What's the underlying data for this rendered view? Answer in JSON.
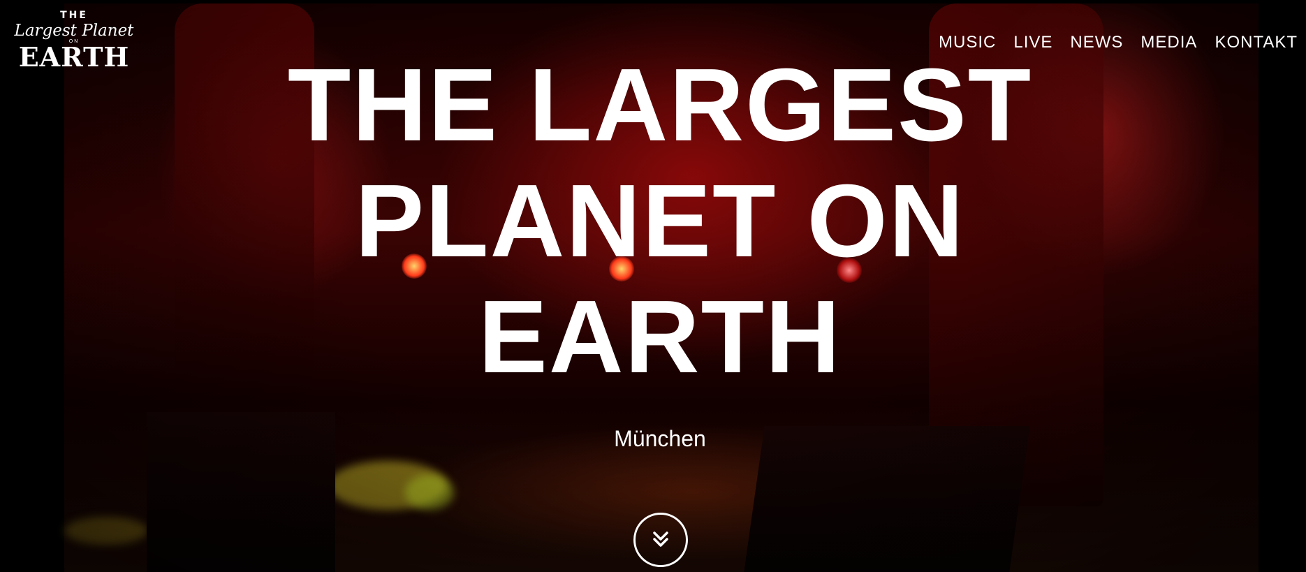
{
  "logo": {
    "line1": "THE",
    "line2": "Largest Planet",
    "line3": "ON",
    "line4": "EARTH"
  },
  "nav": {
    "items": [
      {
        "label": "MUSIC"
      },
      {
        "label": "LIVE"
      },
      {
        "label": "NEWS"
      },
      {
        "label": "MEDIA"
      },
      {
        "label": "KONTAKT"
      }
    ]
  },
  "hero": {
    "title_line1": "THE LARGEST",
    "title_line2": "PLANET ON",
    "title_line3": "EARTH",
    "subtitle": "München",
    "scroll_icon": "double-chevron-down-icon"
  },
  "colors": {
    "text": "#ffffff",
    "stage_red": "#b00a0a",
    "background": "#000000"
  }
}
